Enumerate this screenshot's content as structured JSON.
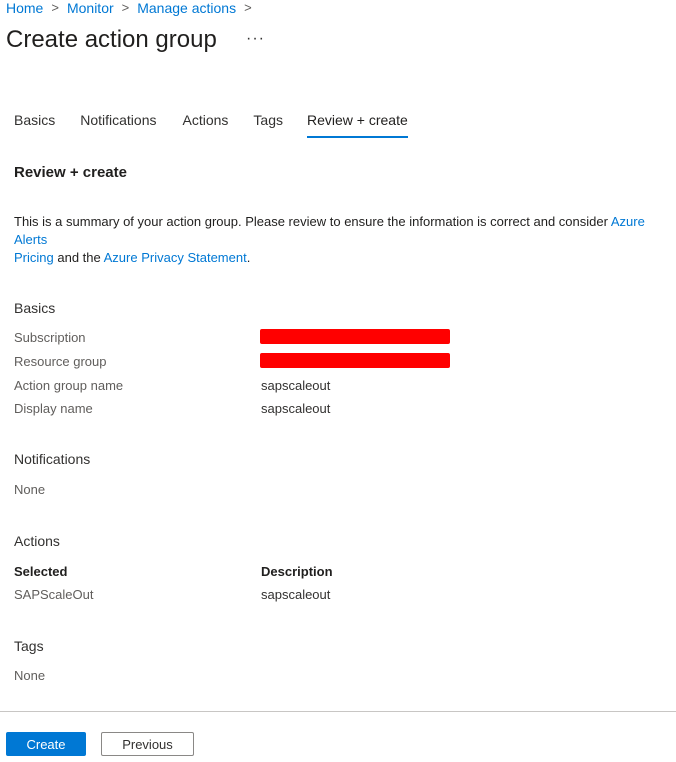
{
  "breadcrumb": {
    "items": [
      "Home",
      "Monitor",
      "Manage actions"
    ]
  },
  "page": {
    "title": "Create action group",
    "more_icon": "more-icon",
    "more_glyph": "···"
  },
  "tabs": [
    {
      "label": "Basics",
      "active": false
    },
    {
      "label": "Notifications",
      "active": false
    },
    {
      "label": "Actions",
      "active": false
    },
    {
      "label": "Tags",
      "active": false
    },
    {
      "label": "Review + create",
      "active": true
    }
  ],
  "review": {
    "heading": "Review + create",
    "summary_text": "This is a summary of your action group. Please review to ensure the information is correct and consider ",
    "link_pricing_1": "Azure Alerts",
    "link_pricing_2": "Pricing",
    "summary_and": " and the ",
    "link_privacy": "Azure Privacy Statement",
    "summary_end": "."
  },
  "basics": {
    "title": "Basics",
    "rows": [
      {
        "label": "Subscription",
        "value": "",
        "redacted": true
      },
      {
        "label": "Resource group",
        "value": "",
        "redacted": true
      },
      {
        "label": "Action group name",
        "value": "sapscaleout",
        "redacted": false
      },
      {
        "label": "Display name",
        "value": "sapscaleout",
        "redacted": false
      }
    ]
  },
  "notifications": {
    "title": "Notifications",
    "value": "None"
  },
  "actions": {
    "title": "Actions",
    "col_selected": "Selected",
    "col_description": "Description",
    "rows": [
      {
        "selected": "SAPScaleOut",
        "description": "sapscaleout"
      }
    ]
  },
  "tags": {
    "title": "Tags",
    "value": "None"
  },
  "footer": {
    "create_label": "Create",
    "previous_label": "Previous"
  },
  "colors": {
    "accent": "#0078d4",
    "redaction": "#ff0000"
  }
}
